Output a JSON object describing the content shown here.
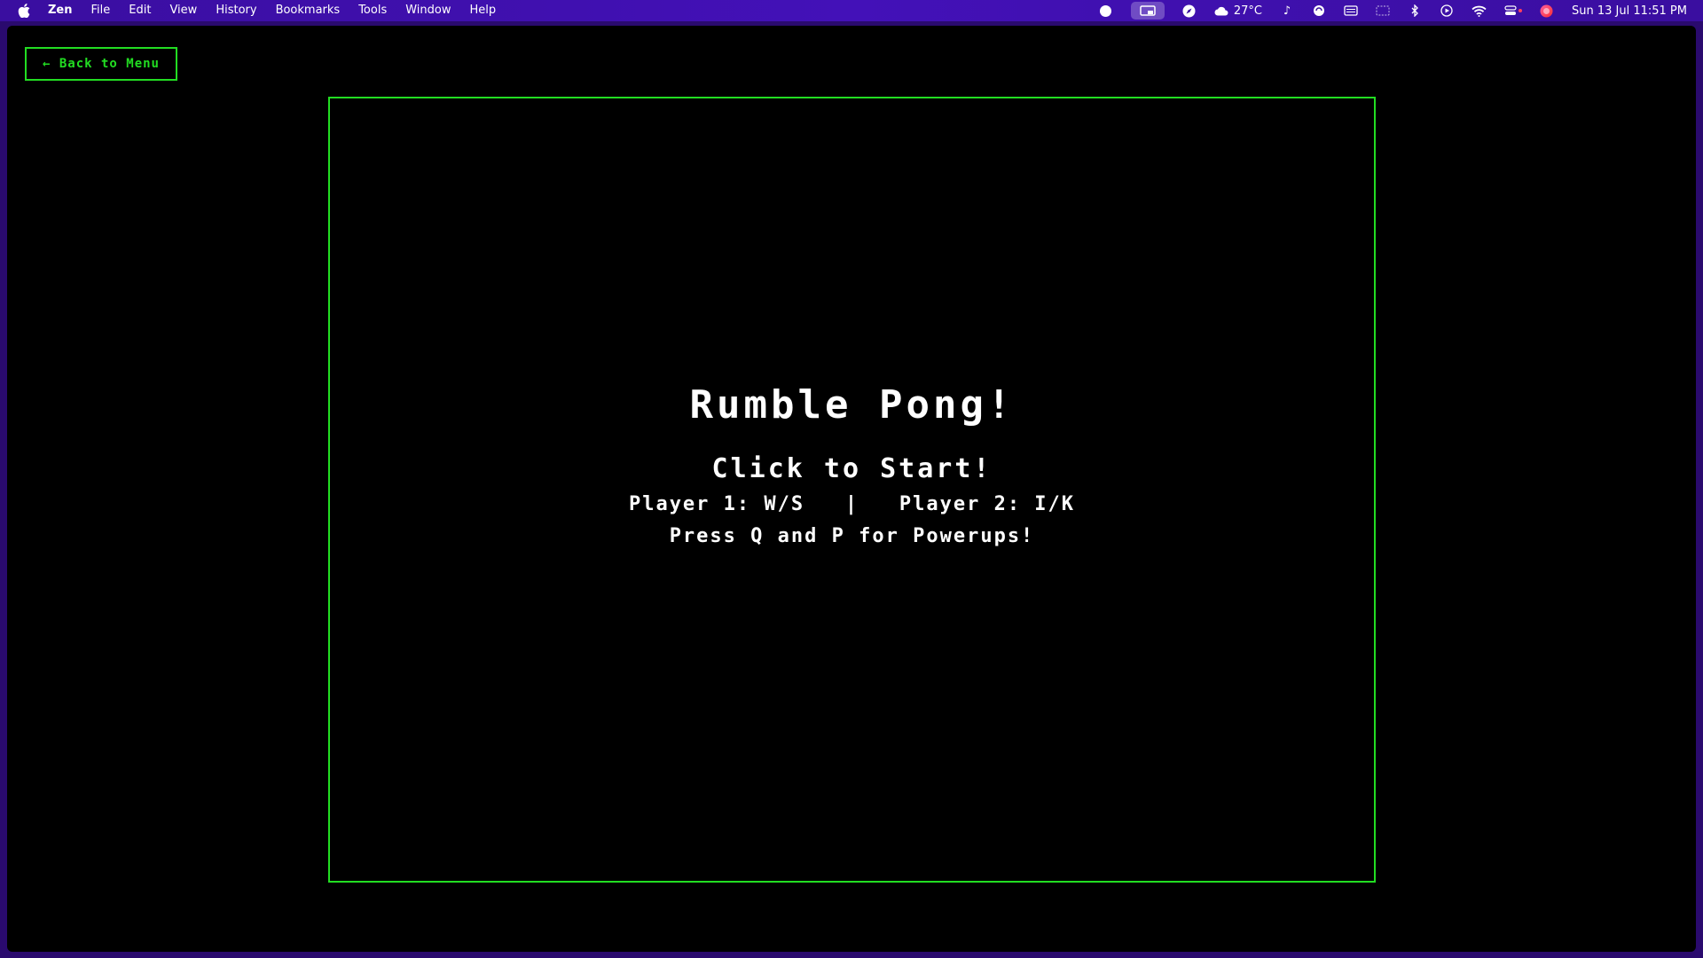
{
  "menubar": {
    "app_name": "Zen",
    "menus": [
      "File",
      "Edit",
      "View",
      "History",
      "Bookmarks",
      "Tools",
      "Window",
      "Help"
    ],
    "weather": "27°C",
    "clock": "Sun 13 Jul  11:51 PM"
  },
  "page": {
    "back_label": "← Back to Menu",
    "title": "Rumble Pong!",
    "start_prompt": "Click to Start!",
    "controls": "Player 1: W/S   |   Player 2: I/K",
    "powerups": "Press Q and P for Powerups!"
  },
  "colors": {
    "accent": "#22dd22",
    "background": "#000000",
    "text": "#ffffff",
    "menubar": "#4311b8"
  }
}
